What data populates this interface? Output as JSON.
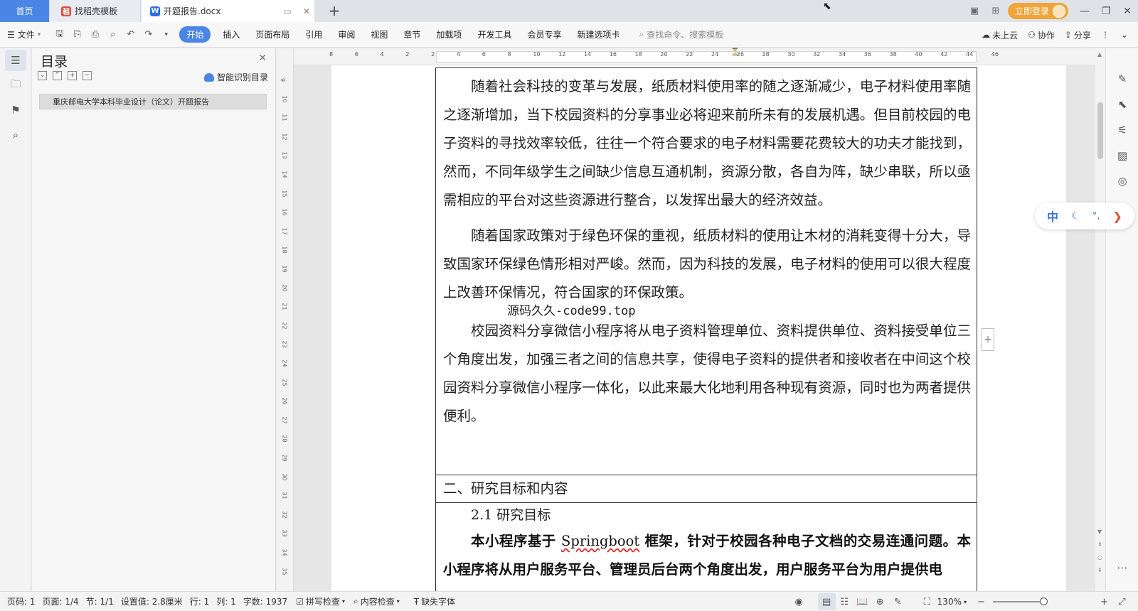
{
  "tabs": {
    "home": "首页",
    "templates": "找稻壳模板",
    "document": "开题报告.docx"
  },
  "titlebar": {
    "login": "立即登录"
  },
  "ribbon": {
    "file": "文件",
    "tabs": [
      "开始",
      "插入",
      "页面布局",
      "引用",
      "审阅",
      "视图",
      "章节",
      "加载项",
      "开发工具",
      "会员专享",
      "新建选项卡"
    ],
    "active_tab": "开始",
    "search_placeholder": "查找命令、搜索模板",
    "cloud": "未上云",
    "collab": "协作",
    "share": "分享"
  },
  "toc": {
    "title": "目录",
    "smart": "智能识别目录",
    "items": [
      "重庆邮电大学本科毕业设计（论文）开题报告"
    ]
  },
  "ruler": {
    "h_ticks": [
      "8",
      "6",
      "4",
      "2",
      "2",
      "4",
      "6",
      "8",
      "10",
      "12",
      "14",
      "16",
      "18",
      "20",
      "22",
      "24",
      "26",
      "28",
      "30",
      "32",
      "34",
      "36",
      "38",
      "40",
      "42",
      "44",
      "46"
    ],
    "v_ticks": [
      "9",
      "10",
      "11",
      "12",
      "13",
      "14",
      "15",
      "16",
      "17",
      "18",
      "19",
      "20",
      "21",
      "22",
      "23",
      "24",
      "25",
      "26",
      "27",
      "28",
      "29",
      "30",
      "31",
      "32",
      "33",
      "34",
      "35"
    ]
  },
  "document": {
    "p1": "随着社会科技的变革与发展，纸质材料使用率的随之逐渐减少，电子材料使用率随之逐渐增加，当下校园资料的分享事业必将迎来前所未有的发展机遇。但目前校园的电子资料的寻找效率较低，往往一个符合要求的电子材料需要花费较大的功夫才能找到，然而，不同年级学生之间缺少信息互通机制，资源分散，各自为阵，缺少串联，所以亟需相应的平台对这些资源进行整合，以发挥出最大的经济效益。",
    "p2": "随着国家政策对于绿色环保的重视，纸质材料的使用让木材的消耗变得十分大，导致国家环保绿色情形相对严峻。然而，因为科技的发展，电子材料的使用可以很大程度上改善环保情况，符合国家的环保政策。",
    "watermark": "源码久久-code99.top",
    "p3": "校园资料分享微信小程序将从电子资料管理单位、资料提供单位、资料接受单位三个角度出发，加强三者之间的信息共享，使得电子资料的提供者和接收者在中间这个校园资料分享微信小程序一体化，以此来最大化地利用各种现有资源，同时也为两者提供便利。",
    "section": "二、研究目标和内容",
    "subsection": "2.1 研究目标",
    "bold_pre": "本小程序基于 ",
    "bold_word": "Springboot",
    "bold_post": " 框架，针对于校园各种电子文档的交易连通问题。本小程序将从用户服务平台、管理员后台两个角度出发，用户服务平台为用户提供电"
  },
  "ime": {
    "mode": "中"
  },
  "status": {
    "page": "页码: 1",
    "pages": "页面: 1/4",
    "section": "节: 1/1",
    "setting": "设置值: 2.8厘米",
    "row": "行: 1",
    "col": "列: 1",
    "words": "字数: 1937",
    "spell": "拼写检查",
    "content": "内容检查",
    "font": "缺失字体",
    "zoom": "130%"
  }
}
